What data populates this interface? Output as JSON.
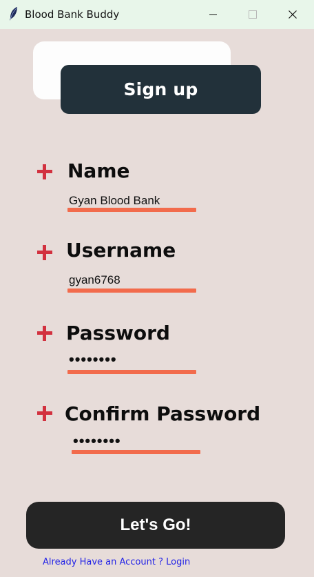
{
  "window": {
    "title": "Blood Bank Buddy",
    "icon": "feather-icon"
  },
  "header": {
    "title": "Sign up"
  },
  "form": {
    "fields": [
      {
        "label": "Name",
        "value": "Gyan Blood Bank",
        "type": "text"
      },
      {
        "label": "Username",
        "value": "gyan6768",
        "type": "text"
      },
      {
        "label": "Password",
        "value": "••••••••",
        "type": "password"
      },
      {
        "label": "Confirm Password",
        "value": "••••••••",
        "type": "password"
      }
    ],
    "submit_label": "Let's Go!",
    "login_link": "Already Have an Account ? Login"
  },
  "colors": {
    "background": "#e7dcd9",
    "header_dark": "#22313a",
    "accent_red": "#d2313f",
    "underline": "#f26b4c",
    "button": "#252525",
    "link": "#2323e6"
  }
}
